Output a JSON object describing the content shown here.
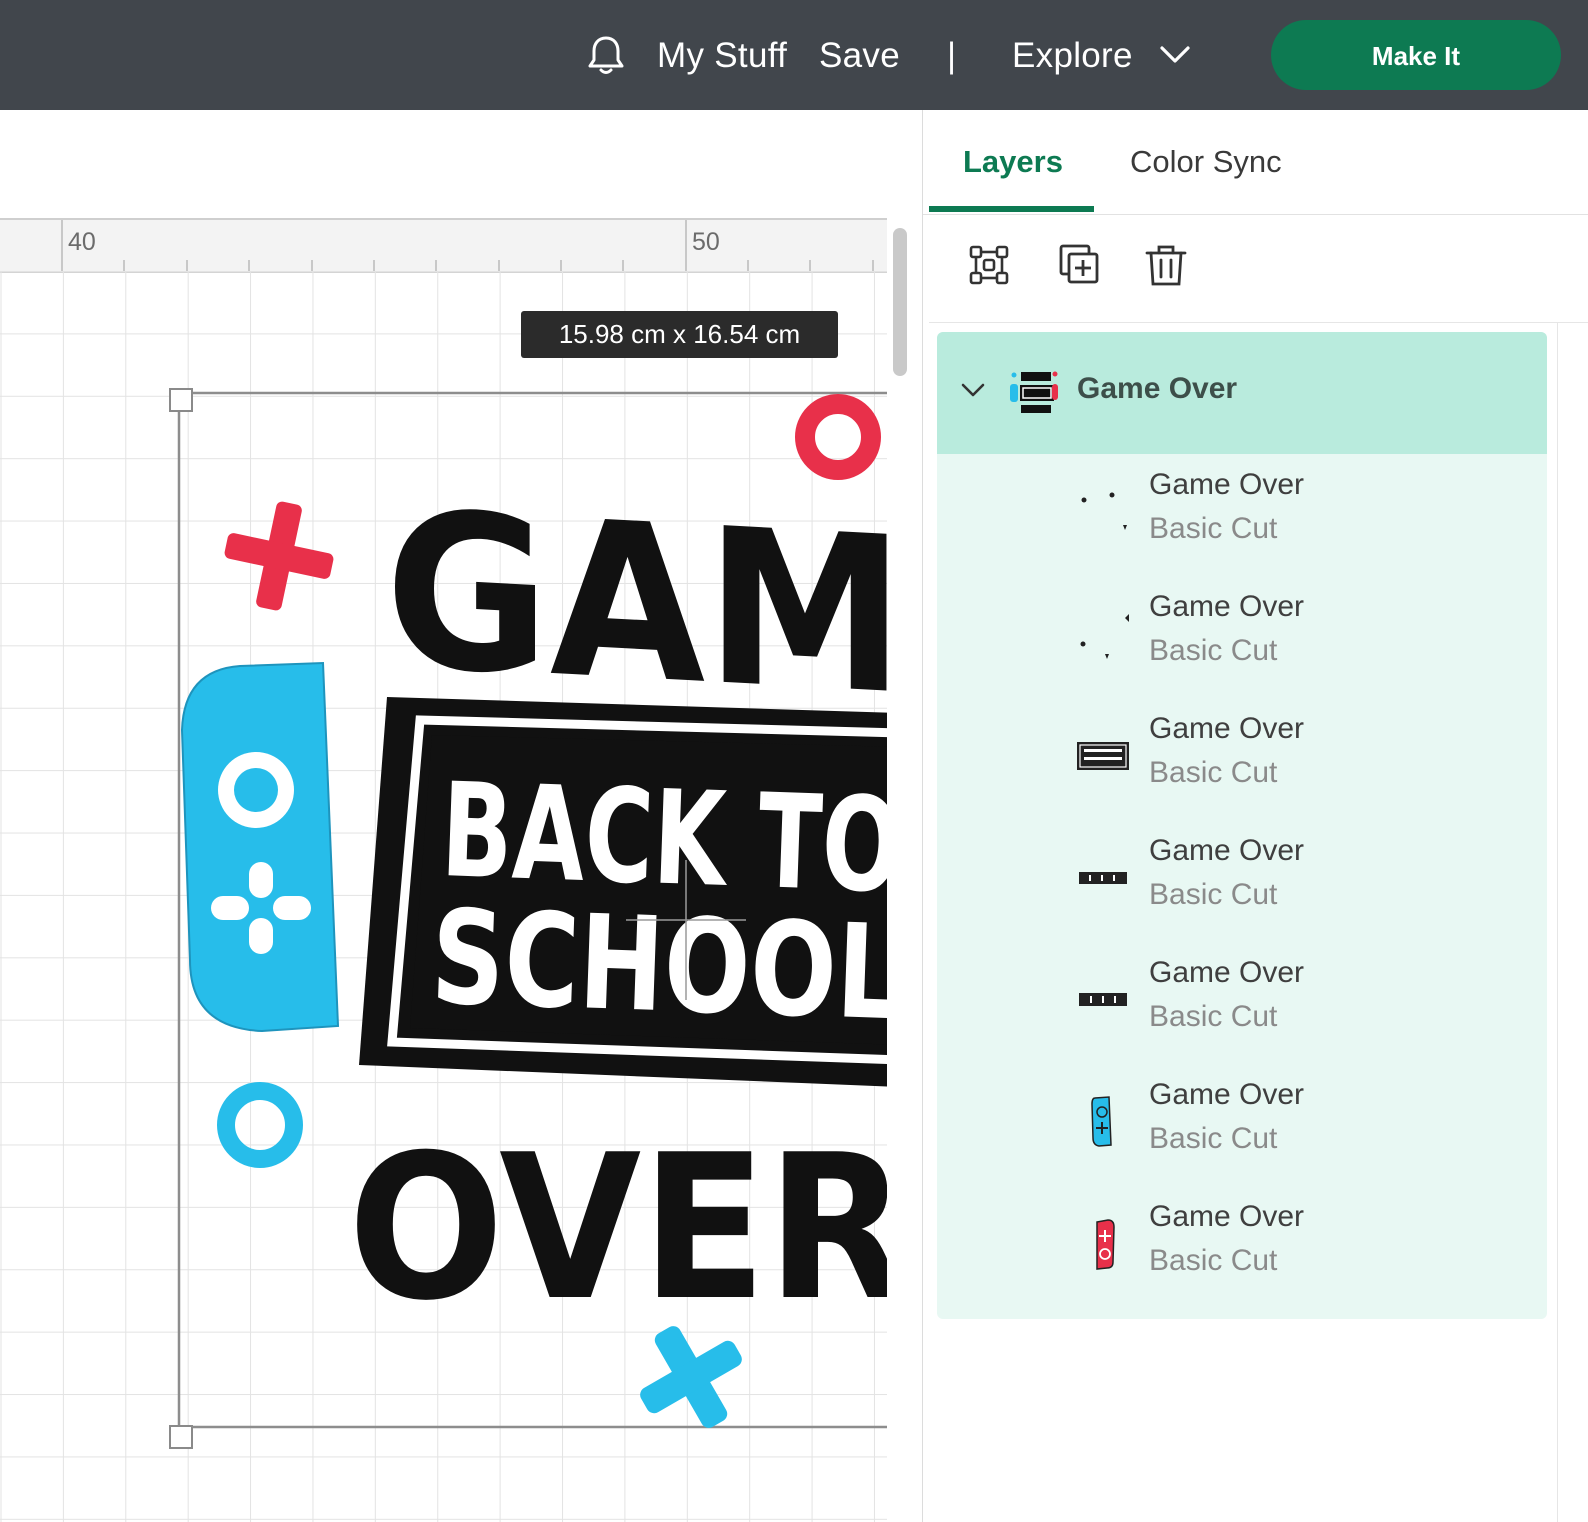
{
  "topbar": {
    "my_stuff": "My Stuff",
    "save": "Save",
    "separator": "|",
    "explore": "Explore",
    "make_it": "Make It",
    "colors": {
      "bar": "#41464c",
      "make_it": "#0d7a52"
    }
  },
  "canvas": {
    "ruler": {
      "left_label": "40",
      "right_label": "50"
    },
    "dimensions": "15.98  cm x 16.54  cm",
    "artwork": {
      "line1": "GAM",
      "line2a": "BACK TO",
      "line2b": "SCHOOL",
      "line3": "OVER"
    }
  },
  "panel": {
    "tabs": {
      "layers": "Layers",
      "color_sync": "Color Sync"
    },
    "tools": [
      "group-icon",
      "duplicate-icon",
      "delete-icon"
    ],
    "group": {
      "title": "Game Over",
      "layers": [
        {
          "name": "Game Over",
          "type": "Basic Cut",
          "thumb": "dots"
        },
        {
          "name": "Game Over",
          "type": "Basic Cut",
          "thumb": "dots-2"
        },
        {
          "name": "Game Over",
          "type": "Basic Cut",
          "thumb": "back-to-school"
        },
        {
          "name": "Game Over",
          "type": "Basic Cut",
          "thumb": "over"
        },
        {
          "name": "Game Over",
          "type": "Basic Cut",
          "thumb": "game"
        },
        {
          "name": "Game Over",
          "type": "Basic Cut",
          "thumb": "blue-controller"
        },
        {
          "name": "Game Over",
          "type": "Basic Cut",
          "thumb": "red-controller"
        }
      ]
    },
    "colors": {
      "accent": "#0d7a52",
      "group_header": "#b9ebdd",
      "group_body": "#e8f8f3"
    }
  }
}
